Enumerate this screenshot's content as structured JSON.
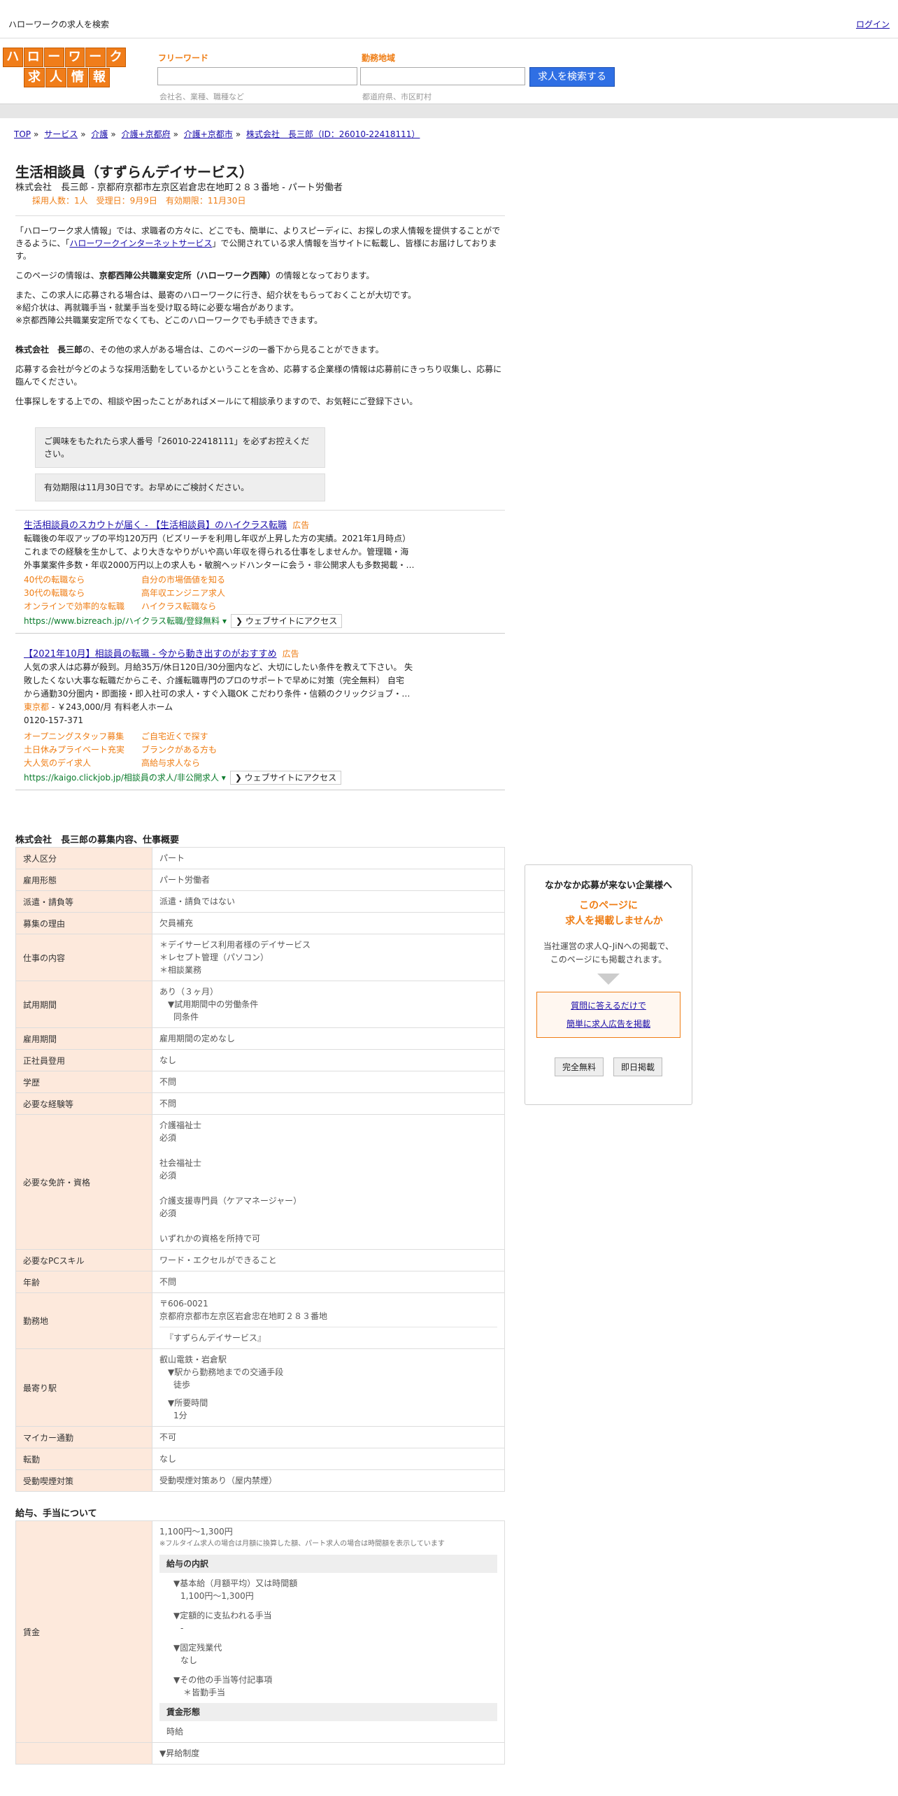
{
  "header": {
    "site_title": "ハローワークの求人を検索",
    "login": "ログイン",
    "logo_row1": [
      "ハ",
      "ロ",
      "ー",
      "ワ",
      "ー",
      "ク"
    ],
    "logo_row2": [
      "求",
      "人",
      "情",
      "報"
    ],
    "freeword_label": "フリーワード",
    "freeword_hint": "会社名、業種、職種など",
    "area_label": "勤務地域",
    "area_hint": "都道府県、市区町村",
    "search_button": "求人を検索する"
  },
  "breadcrumb": [
    "TOP",
    "サービス",
    "介護",
    "介護+京都府",
    "介護+京都市",
    "株式会社　長三郎（ID：26010-22418111）"
  ],
  "job": {
    "title": "生活相談員（すずらんデイサービス）",
    "company_line": "株式会社　長三郎 - 京都府京都市左京区岩倉忠在地町２８３番地 - パート労働者",
    "meta": "採用人数：1人　受理日：9月9日　有効期限：11月30日"
  },
  "intro": {
    "p1_a": "「ハローワーク求人情報」では、求職者の方々に、どこでも、簡単に、よりスピーディに、お探しの求人情報を提供することができるように、「",
    "p1_link": "ハローワークインターネットサービス",
    "p1_b": "」で公開されている求人情報を当サイトに転載し、皆様にお届けしております。",
    "p2_a": "このページの情報は、",
    "p2_bold": "京都西陣公共職業安定所（ハローワーク西陣）",
    "p2_b": "の情報となっております。",
    "p3_l1": "また、この求人に応募される場合は、最寄のハローワークに行き、紹介状をもらっておくことが大切です。",
    "p3_l2": "※紹介状は、再就職手当・就業手当を受け取る時に必要な場合があります。",
    "p3_l3": "※京都西陣公共職業安定所でなくても、どこのハローワークでも手続きできます。",
    "p4_bold": "株式会社　長三郎",
    "p4_rest": "の、その他の求人がある場合は、このページの一番下から見ることができます。",
    "p5": "応募する会社が今どのような採用活動をしているかということを含め、応募する企業様の情報は応募前にきっちり収集し、応募に臨んでください。",
    "p6": "仕事探しをする上での、相談や困ったことがあればメールにて相談承りますので、お気軽にご登録下さい。",
    "box1": "ご興味をもたれたら求人番号「26010-22418111」を必ずお控えください。",
    "box2": "有効期限は11月30日です。お早めにご検討ください。"
  },
  "ads": [
    {
      "title": "生活相談員のスカウトが届く - 【生活相談員】のハイクラス転職",
      "badge": "広告",
      "desc1": "転職後の年収アップの平均120万円（ビズリーチを利用し年収が上昇した方の実績。2021年1月時点）",
      "desc2": "これまでの経験を生かして、より大きなやりがいや高い年収を得られる仕事をしませんか。管理職・海",
      "desc3": "外事業案件多数・年収2000万円以上の求人も・敏腕ヘッドハンターに会う・非公開求人も多数掲載・…",
      "links": [
        "40代の転職なら",
        "自分の市場価値を知る",
        "30代の転職なら",
        "高年収エンジニア求人",
        "オンラインで効率的な転職",
        "ハイクラス転職なら"
      ],
      "url": "https://www.bizreach.jp/ハイクラス転職/登録無料",
      "access": "❯ ウェブサイトにアクセス"
    },
    {
      "title": "【2021年10月】相談員の転職 - 今から動き出すのがおすすめ",
      "badge": "広告",
      "desc1": "人気の求人は応募が殺到。月給35万/休日120日/30分圏内など、大切にしたい条件を教えて下さい。 失",
      "desc2": "敗したくない大事な転職だからこそ、介護転職専門のプロのサポートで早めに対策（完全無料） 自宅",
      "desc3": "から通勤30分圏内・即面接・即入社可の求人・すぐ入職OK こだわり条件・信頼のクリックジョブ・…",
      "loc": "東京都",
      "loc_rest": " - ￥243,000/月 有料老人ホーム",
      "phone": "0120-157-371",
      "links": [
        "オープニングスタッフ募集",
        "ご自宅近くで探す",
        "土日休みプライベート充実",
        "ブランクがある方も",
        "大人気のデイ求人",
        "高給与求人なら"
      ],
      "url": "https://kaigo.clickjob.jp/相談員の求人/非公開求人",
      "access": "❯ ウェブサイトにアクセス"
    }
  ],
  "summary": {
    "title": "株式会社　長三郎の募集内容、仕事概要",
    "rows": {
      "r1": {
        "k": "求人区分",
        "v": "パート"
      },
      "r2": {
        "k": "雇用形態",
        "v": "パート労働者"
      },
      "r3": {
        "k": "派遣・請負等",
        "v": "派遣・請負ではない"
      },
      "r4": {
        "k": "募集の理由",
        "v": "欠員補充"
      },
      "r5": {
        "k": "仕事の内容",
        "v1": "＊デイサービス利用者様のデイサービス",
        "v2": "＊レセプト管理（パソコン）",
        "v3": "＊相談業務"
      },
      "r6": {
        "k": "試用期間",
        "v1": "あり（３ヶ月）",
        "v2": "▼試用期間中の労働条件",
        "v3": "同条件"
      },
      "r7": {
        "k": "雇用期間",
        "v": "雇用期間の定めなし"
      },
      "r8": {
        "k": "正社員登用",
        "v": "なし"
      },
      "r9": {
        "k": "学歴",
        "v": "不問"
      },
      "r10": {
        "k": "必要な経験等",
        "v": "不問"
      },
      "r11": {
        "k": "必要な免許・資格",
        "v1": "介護福祉士",
        "v2": "必須",
        "v3": "社会福祉士",
        "v4": "必須",
        "v5": "介護支援専門員（ケアマネージャー）",
        "v6": "必須",
        "v7": "いずれかの資格を所持で可"
      },
      "r12": {
        "k": "必要なPCスキル",
        "v": "ワード・エクセルができること"
      },
      "r13": {
        "k": "年齢",
        "v": "不問"
      },
      "r14": {
        "k": "勤務地",
        "v1": "〒606-0021",
        "v2": "京都府京都市左京区岩倉忠在地町２８３番地",
        "v3": "『すずらんデイサービス』"
      },
      "r15": {
        "k": "最寄り駅",
        "v1": "叡山電鉄・岩倉駅",
        "v2": "▼駅から勤務地までの交通手段",
        "v3": "徒歩",
        "v4": "▼所要時間",
        "v5": "1分"
      },
      "r16": {
        "k": "マイカー通勤",
        "v": "不可"
      },
      "r17": {
        "k": "転勤",
        "v": "なし"
      },
      "r18": {
        "k": "受動喫煙対策",
        "v": "受動喫煙対策あり（屋内禁煙）"
      }
    }
  },
  "pay": {
    "title": "給与、手当について",
    "k": "賃金",
    "range": "1,100円〜1,300円",
    "note": "※フルタイム求人の場合は月額に換算した額、パート求人の場合は時間額を表示しています",
    "breakdown_head": "給与の内訳",
    "b1": "▼基本給（月額平均）又は時間額",
    "b1v": "1,100円〜1,300円",
    "b2": "▼定額的に支払われる手当",
    "b2v": "-",
    "b3": "▼固定残業代",
    "b3v": "なし",
    "b4": "▼その他の手当等付記事項",
    "b4v": "＊皆勤手当",
    "form_head": "賃金形態",
    "form_v": "時給",
    "next": "▼昇給制度"
  },
  "sidebox": {
    "title": "なかなか応募が来ない企業様へ",
    "cta1": "このページに",
    "cta2": "求人を掲載しませんか",
    "body1": "当社運営の求人Q-JiNへの掲載で、",
    "body2": "このページにも掲載されます。",
    "link1": "質問に答えるだけで",
    "link2": "簡単に求人広告を掲載",
    "btn1": "完全無料",
    "btn2": "即日掲載"
  }
}
